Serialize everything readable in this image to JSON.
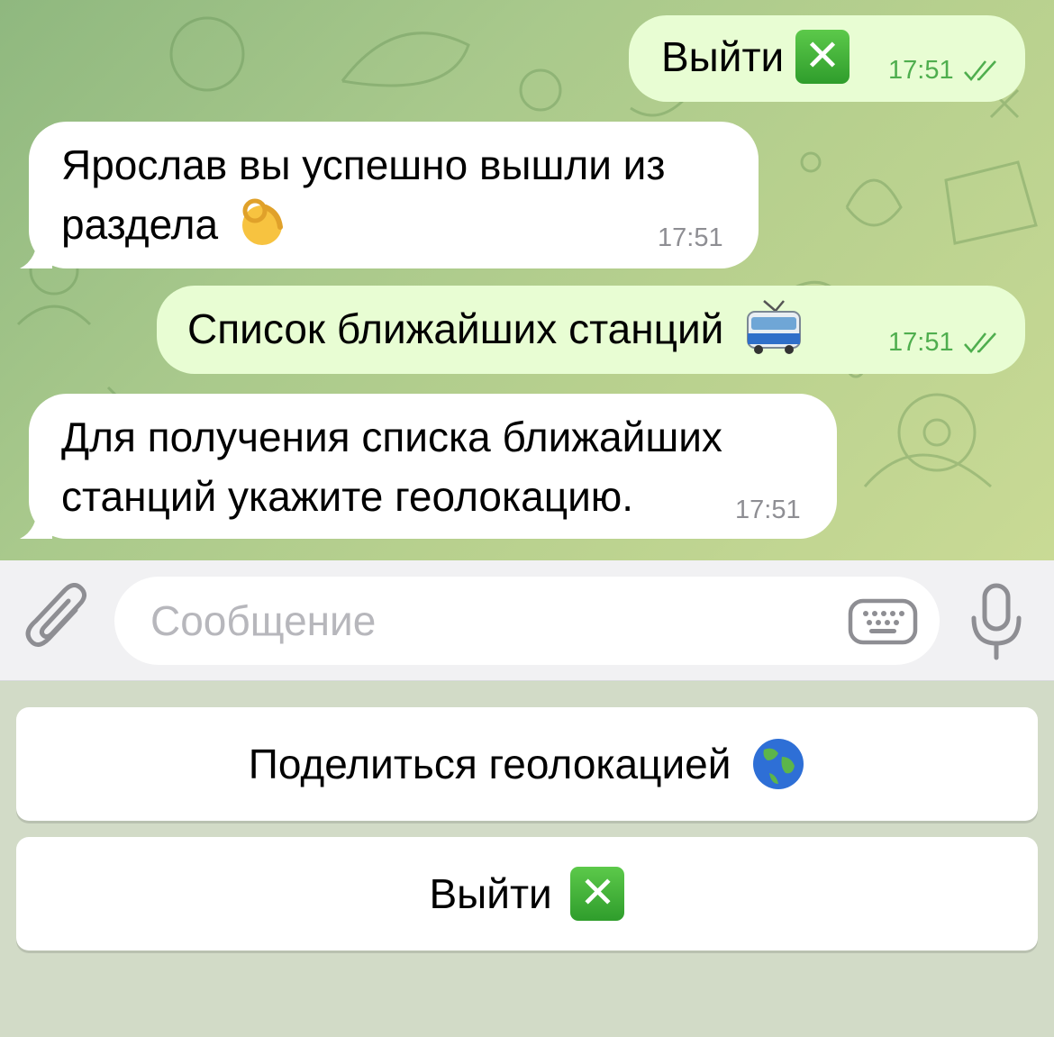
{
  "messages": [
    {
      "direction": "out",
      "text": "Выйти",
      "emoji": "cross-mark-button",
      "time": "17:51",
      "status": "read"
    },
    {
      "direction": "in",
      "lines": [
        "Ярослав вы успешно вышли из",
        "раздела"
      ],
      "emoji": "ok-hand",
      "time": "17:51"
    },
    {
      "direction": "out",
      "text": "Список ближайших станций",
      "emoji": "trolleybus",
      "time": "17:51",
      "status": "read"
    },
    {
      "direction": "in",
      "lines": [
        "Для получения списка ближайших",
        "станций укажите геолокацию."
      ],
      "time": "17:51"
    }
  ],
  "input": {
    "placeholder": "Сообщение",
    "icons": [
      "paperclip-icon",
      "keyboard-icon",
      "microphone-icon"
    ]
  },
  "keyboard_buttons": [
    {
      "label": "Поделиться геолокацией",
      "emoji": "globe"
    },
    {
      "label": "Выйти",
      "emoji": "cross-mark-button"
    }
  ],
  "colors": {
    "outgoing_bubble": "#e8fdd3",
    "incoming_bubble": "#ffffff",
    "read_checks": "#4fae4e",
    "accent_green": "#3aa63a"
  }
}
